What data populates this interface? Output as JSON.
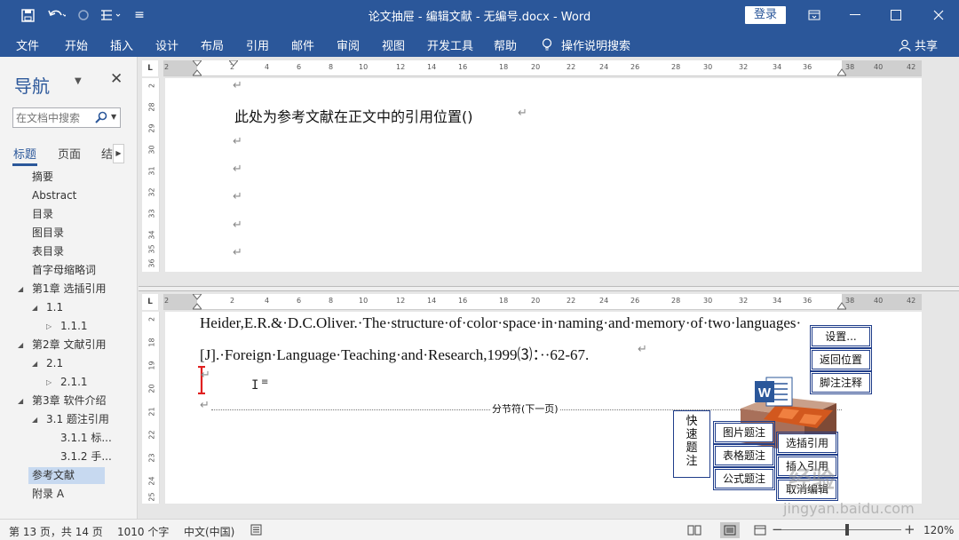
{
  "window": {
    "title": "论文抽屉 - 编辑文献 - 无编号.docx - Word",
    "login_label": "登录",
    "qa_more": "≡"
  },
  "ribbon": {
    "tabs": [
      "文件",
      "开始",
      "插入",
      "设计",
      "布局",
      "引用",
      "邮件",
      "审阅",
      "视图",
      "开发工具",
      "帮助",
      "操作说明搜索"
    ],
    "share_label": "共享"
  },
  "nav": {
    "title": "导航",
    "search_placeholder": "在文档中搜索",
    "tabs": [
      "标题",
      "页面",
      "结"
    ],
    "items": [
      {
        "label": "摘要"
      },
      {
        "label": "Abstract"
      },
      {
        "label": "目录"
      },
      {
        "label": "图目录"
      },
      {
        "label": "表目录"
      },
      {
        "label": "首字母缩略词"
      },
      {
        "label": "第1章 选插引用"
      },
      {
        "label": "1.1"
      },
      {
        "label": "1.1.1"
      },
      {
        "label": "第2章 文献引用"
      },
      {
        "label": "2.1"
      },
      {
        "label": "2.1.1"
      },
      {
        "label": "第3章 软件介绍"
      },
      {
        "label": "3.1 题注引用"
      },
      {
        "label": "3.1.1 标..."
      },
      {
        "label": "3.1.2 手..."
      },
      {
        "label": "参考文献"
      },
      {
        "label": "附录 A"
      }
    ]
  },
  "ruler": {
    "corner": "L",
    "numbers": [
      "2",
      "2",
      "4",
      "6",
      "8",
      "10",
      "12",
      "14",
      "16",
      "18",
      "20",
      "22",
      "24",
      "26",
      "28",
      "30",
      "32",
      "34",
      "36",
      "38",
      "40",
      "42"
    ],
    "vertical_top": [
      "2",
      "28",
      "29",
      "30",
      "31",
      "32",
      "33",
      "34",
      "35",
      "36"
    ],
    "vertical_bottom": [
      "2",
      "18",
      "19",
      "20",
      "21",
      "22",
      "23",
      "24",
      "25"
    ]
  },
  "doc_top": {
    "line1": "此处为参考文献在正文中的引用位置()"
  },
  "doc_bottom": {
    "ref_line1": "Heider,E.R.&·D.C.Oliver.·The·structure·of·color·space·in·naming·and·memory·of·two·languages·",
    "ref_line2": "[J].·Foreign·Language·Teaching·and·Research,1999⑶：··62-67.",
    "section_break": "分节符(下一页)"
  },
  "plugin": {
    "settings": "设置...",
    "return": "返回位置",
    "footnote": "脚注注释",
    "quick_caption": [
      "快",
      "速",
      "题",
      "注"
    ],
    "figure_caption": "图片题注",
    "table_caption": "表格题注",
    "formula_caption": "公式题注",
    "select_ref": "选插引用",
    "insert_ref": "插入引用",
    "cancel_edit": "取消编辑",
    "word_letter": "W"
  },
  "status": {
    "page": "第 13 页，共 14 页",
    "words": "1010 个字",
    "language": "中文(中国)",
    "zoom": "120%"
  },
  "watermark": {
    "brand": "经验",
    "url": "jingyan.baidu.com"
  },
  "colors": {
    "accent": "#2b579a",
    "toolbar_border": "#1f3d8a"
  }
}
